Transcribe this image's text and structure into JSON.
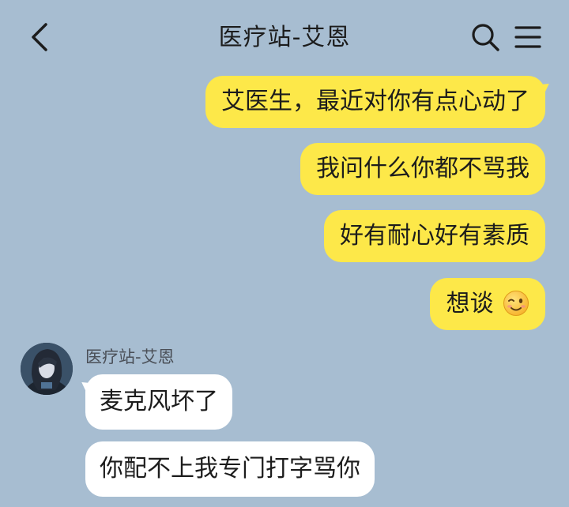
{
  "header": {
    "title": "医疗站-艾恩",
    "back_icon": "chevron-left-icon",
    "search_icon": "search-icon",
    "menu_icon": "menu-icon"
  },
  "messages": {
    "outgoing": [
      {
        "text": "艾医生，最近对你有点心动了"
      },
      {
        "text": "我问什么你都不骂我"
      },
      {
        "text": "好有耐心好有素质"
      },
      {
        "text": "想谈",
        "emoji": "winking-face-icon"
      }
    ],
    "incoming_sender": "医疗站-艾恩",
    "incoming": [
      {
        "text": "麦克风坏了"
      },
      {
        "text": "你配不上我专门打字骂你"
      }
    ]
  },
  "colors": {
    "background": "#a7bdd1",
    "outgoing_bubble": "#fde849",
    "incoming_bubble": "#ffffff"
  }
}
